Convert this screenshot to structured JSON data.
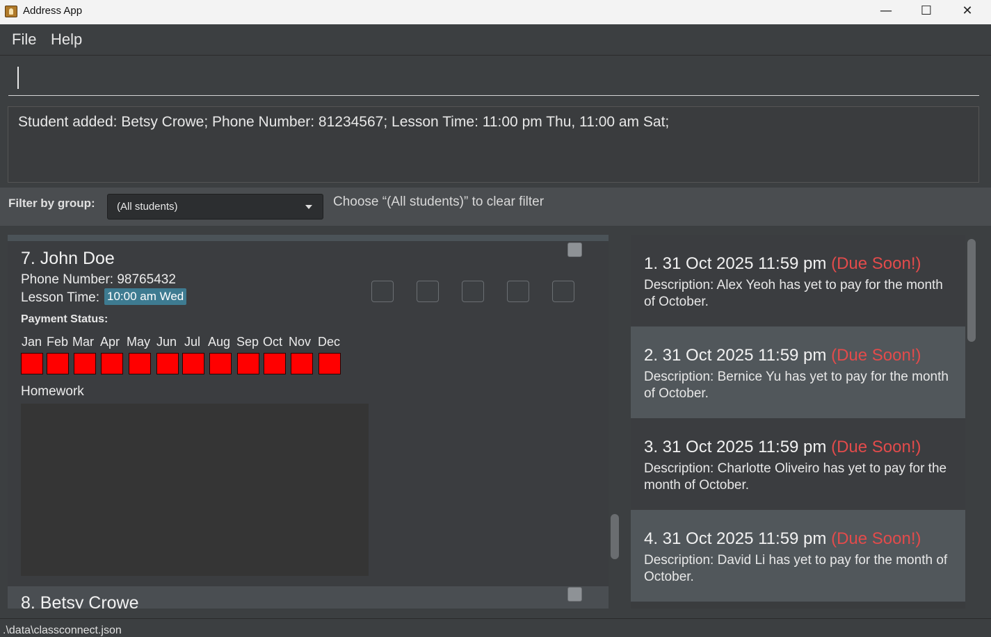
{
  "window": {
    "title": "Address App",
    "minimize": "—",
    "maximize": "☐",
    "close": "✕"
  },
  "menu": {
    "file": "File",
    "help": "Help"
  },
  "command": {
    "value": ""
  },
  "result": {
    "text": "Student added: Betsy Crowe; Phone Number: 81234567; Lesson Time: 11:00 pm Thu, 11:00 am Sat;"
  },
  "filter": {
    "label": "Filter by group:",
    "selected": "(All students)",
    "hint": "Choose “(All students)” to clear filter"
  },
  "students": [
    {
      "name": "7. John Doe",
      "phone": "Phone Number: 98765432",
      "lesson_label": "Lesson Time:",
      "lesson_tag": "10:00 am Wed",
      "payment_label": "Payment Status:",
      "months": [
        "Jan",
        "Feb",
        "Mar",
        "Apr",
        "May",
        "Jun",
        "Jul",
        "Aug",
        "Sep",
        "Oct",
        "Nov",
        "Dec"
      ],
      "homework_label": "Homework",
      "paid_color": "#ff0000"
    },
    {
      "name": "8. Betsy Crowe"
    }
  ],
  "reminders": [
    {
      "head": "1. 31 Oct 2025 11:59 pm",
      "due": "(Due Soon!)",
      "desc": "Description: Alex Yeoh has yet to pay for the month of October."
    },
    {
      "head": "2. 31 Oct 2025 11:59 pm",
      "due": "(Due Soon!)",
      "desc": "Description: Bernice Yu has yet to pay for the month of October."
    },
    {
      "head": "3. 31 Oct 2025 11:59 pm",
      "due": "(Due Soon!)",
      "desc": "Description: Charlotte Oliveiro has yet to pay for the month of October."
    },
    {
      "head": "4. 31 Oct 2025 11:59 pm",
      "due": "(Due Soon!)",
      "desc": "Description: David Li has yet to pay for the month of October."
    }
  ],
  "status": {
    "path": ".\\data\\classconnect.json"
  },
  "colors": {
    "due": "#e34b4b",
    "lesson_tag": "#3e7b91",
    "background": "#3c3f41"
  }
}
